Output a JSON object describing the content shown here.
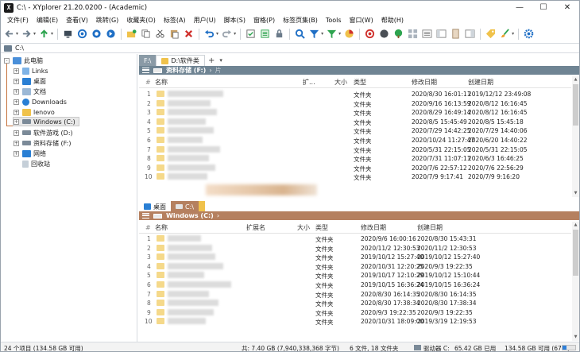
{
  "window": {
    "app_icon_label": "X",
    "title": "C:\\ - XYplorer 21.20.0200 - (Academic)",
    "minimize": "—",
    "maximize": "☐",
    "close": "✕"
  },
  "menu": [
    "文件(F)",
    "编辑(E)",
    "查看(V)",
    "跳转(G)",
    "收藏夹(O)",
    "标签(A)",
    "用户(U)",
    "脚本(S)",
    "窗格(P)",
    "标签页集(B)",
    "Tools",
    "窗口(W)",
    "帮助(H)"
  ],
  "toolbar_icons": [
    "back-icon",
    "forward-icon",
    "up-icon",
    "sep",
    "computer-icon",
    "browse-icon",
    "find-icon",
    "go-icon",
    "sep",
    "new-folder-icon",
    "copy-icon",
    "cut-icon",
    "paste-icon",
    "delete-icon",
    "sep",
    "undo-icon",
    "redo-icon",
    "sep",
    "select-icon",
    "filter-icon",
    "lock-icon",
    "sep",
    "search-icon",
    "filter-funnel-icon",
    "color-filter-icon",
    "pie-icon",
    "sep",
    "target-icon",
    "circle-icon",
    "tree-icon",
    "grid-icon",
    "list-icon",
    "panel-icon",
    "dual-pane-icon",
    "sep",
    "tags-icon",
    "brush-icon",
    "sep",
    "settings-icon"
  ],
  "address": {
    "value": "C:\\"
  },
  "tree": {
    "items": [
      {
        "label": "此电脑",
        "level": 0,
        "expander": "-",
        "icon": "pc"
      },
      {
        "label": "Links",
        "level": 1,
        "expander": "+",
        "icon": "links"
      },
      {
        "label": "桌面",
        "level": 1,
        "expander": "+",
        "icon": "desktop"
      },
      {
        "label": "文档",
        "level": 1,
        "expander": "+",
        "icon": "docs"
      },
      {
        "label": "Downloads",
        "level": 1,
        "expander": "+",
        "icon": "download"
      },
      {
        "label": "lenovo",
        "level": 1,
        "expander": "+",
        "icon": "user"
      },
      {
        "label": "Windows (C:)",
        "level": 1,
        "expander": "+",
        "icon": "drive",
        "selected": true
      },
      {
        "label": "软件游戏 (D:)",
        "level": 1,
        "expander": "+",
        "icon": "drive"
      },
      {
        "label": "资料存储 (F:)",
        "level": 1,
        "expander": "+",
        "icon": "drive"
      },
      {
        "label": "网络",
        "level": 1,
        "expander": "+",
        "icon": "network"
      },
      {
        "label": "回收站",
        "level": 1,
        "expander": "",
        "icon": "recycle"
      }
    ]
  },
  "pane1": {
    "tabs": [
      {
        "label": "F:\\",
        "active": false
      },
      {
        "label": "D:\\软件类",
        "active": true
      }
    ],
    "add_tab": "+",
    "tab_menu": "▾",
    "path": "资料存储 (F:)",
    "path_end": "片",
    "columns": {
      "num": "#",
      "name": "名称",
      "ext": "扩...",
      "size": "大小",
      "type": "类型",
      "modified": "修改日期",
      "created": "创建日期"
    },
    "rows": [
      {
        "num": "1",
        "type": "文件夹",
        "modified": "2020/8/30 16:01:11",
        "created": "2019/12/12 23:49:08"
      },
      {
        "num": "2",
        "type": "文件夹",
        "modified": "2020/9/16 16:13:59",
        "created": "2020/8/12 16:16:45"
      },
      {
        "num": "3",
        "type": "文件夹",
        "modified": "2020/8/29 16:49:14",
        "created": "2020/8/12 16:16:45"
      },
      {
        "num": "4",
        "type": "文件夹",
        "modified": "2020/8/5 15:45:49",
        "created": "2020/8/5 15:45:18"
      },
      {
        "num": "5",
        "type": "文件夹",
        "modified": "2020/7/29 14:42:25",
        "created": "2020/7/29 14:40:06"
      },
      {
        "num": "6",
        "type": "文件夹",
        "modified": "2020/10/24 11:27:47",
        "created": "2020/6/20 14:40:22"
      },
      {
        "num": "7",
        "type": "文件夹",
        "modified": "2020/5/31 22:15:05",
        "created": "2020/5/31 22:15:05"
      },
      {
        "num": "8",
        "type": "文件夹",
        "modified": "2020/7/31 11:07:11",
        "created": "2020/6/3 16:46:25"
      },
      {
        "num": "9",
        "type": "文件夹",
        "modified": "2020/7/6 22:57:12",
        "created": "2020/7/6 22:56:29"
      },
      {
        "num": "10",
        "type": "文件夹",
        "modified": "2020/7/9 9:17:41",
        "created": "2020/7/9 9:16:20"
      }
    ]
  },
  "pane2": {
    "tabs": [
      {
        "label": "桌面",
        "active": false
      },
      {
        "label": "C:\\",
        "active": true
      }
    ],
    "path": "Windows (C:)",
    "columns": {
      "num": "#",
      "name": "名称",
      "ext": "扩展名",
      "size": "大小",
      "type": "类型",
      "modified": "修改日期",
      "created": "创建日期"
    },
    "rows": [
      {
        "num": "1",
        "type": "文件夹",
        "modified": "2020/9/6 16:00:16",
        "created": "2020/8/30 15:43:31"
      },
      {
        "num": "2",
        "type": "文件夹",
        "modified": "2020/11/2 12:30:53",
        "created": "2020/11/2 12:30:53"
      },
      {
        "num": "3",
        "type": "文件夹",
        "modified": "2019/10/12 15:27:40",
        "created": "2019/10/12 15:27:40"
      },
      {
        "num": "4",
        "type": "文件夹",
        "modified": "2020/10/31 12:20:25",
        "created": "2020/9/3 19:22:35"
      },
      {
        "num": "5",
        "type": "文件夹",
        "modified": "2019/10/17 12:10:29",
        "created": "2019/10/12 15:10:44"
      },
      {
        "num": "6",
        "type": "文件夹",
        "modified": "2019/10/15 16:36:24",
        "created": "2019/10/15 16:36:24"
      },
      {
        "num": "7",
        "type": "文件夹",
        "modified": "2020/8/30 16:14:35",
        "created": "2020/8/30 16:14:35"
      },
      {
        "num": "8",
        "type": "文件夹",
        "modified": "2020/8/30 17:38:34",
        "created": "2020/8/30 17:38:34"
      },
      {
        "num": "9",
        "type": "文件夹",
        "modified": "2020/9/3 19:22:35",
        "created": "2020/9/3 19:22:35"
      },
      {
        "num": "10",
        "type": "文件夹",
        "modified": "2020/10/31 18:09:00",
        "created": "2019/3/19 12:19:53"
      }
    ]
  },
  "status": {
    "items": "24 个项目 (134.58 GB 可用)",
    "total": "共: 7.40 GB (7,940,338,368 字节)",
    "selection": "6 文件, 18 文件夹",
    "drive_label": "驱动器 C:",
    "used": "65.42 GB 已用",
    "free": "134.58 GB 可用 (67%)",
    "used_fraction": 0.33
  },
  "colors": {
    "pane1_accent": "#6f8493",
    "pane2_accent": "#b5805f",
    "folder": "#f5d98a",
    "link_blue": "#2e7fd9"
  }
}
